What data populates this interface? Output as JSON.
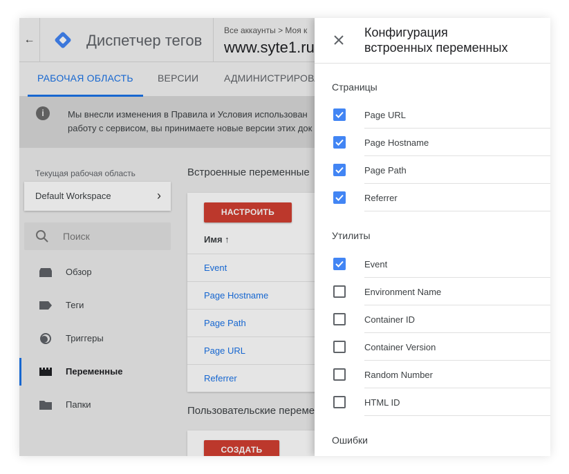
{
  "header": {
    "back_glyph": "←",
    "app_title": "Диспетчер тегов",
    "breadcrumb": "Все аккаунты > Моя к",
    "container_name": "www.syte1.ru"
  },
  "tabs": [
    {
      "label": "РАБОЧАЯ ОБЛАСТЬ",
      "active": true
    },
    {
      "label": "ВЕРСИИ",
      "active": false
    },
    {
      "label": "АДМИНИСТРИРОВА",
      "active": false
    }
  ],
  "notice": {
    "line1": "Мы внесли изменения в Правила и Условия использован",
    "line2": "работу с сервисом, вы принимаете новые версии этих док"
  },
  "workspace": {
    "label": "Текущая рабочая область",
    "name": "Default Workspace",
    "chevron": "›"
  },
  "search": {
    "placeholder": "Поиск"
  },
  "nav": [
    {
      "label": "Обзор",
      "icon": "overview-icon",
      "active": false
    },
    {
      "label": "Теги",
      "icon": "tag-icon",
      "active": false
    },
    {
      "label": "Триггеры",
      "icon": "trigger-icon",
      "active": false
    },
    {
      "label": "Переменные",
      "icon": "variables-icon",
      "active": true
    },
    {
      "label": "Папки",
      "icon": "folder-icon",
      "active": false
    }
  ],
  "builtin": {
    "title": "Встроенные переменные",
    "button": "НАСТРОИТЬ",
    "column": "Имя",
    "sort_glyph": "↑",
    "rows": [
      "Event",
      "Page Hostname",
      "Page Path",
      "Page URL",
      "Referrer"
    ]
  },
  "user_vars": {
    "title": "Пользовательские переме",
    "button": "СОЗДАТЬ"
  },
  "panel": {
    "title_line1": "Конфигурация",
    "title_line2": "встроенных переменных",
    "groups": [
      {
        "label": "Страницы",
        "items": [
          {
            "label": "Page URL",
            "checked": true
          },
          {
            "label": "Page Hostname",
            "checked": true
          },
          {
            "label": "Page Path",
            "checked": true
          },
          {
            "label": "Referrer",
            "checked": true
          }
        ]
      },
      {
        "label": "Утилиты",
        "items": [
          {
            "label": "Event",
            "checked": true
          },
          {
            "label": "Environment Name",
            "checked": false
          },
          {
            "label": "Container ID",
            "checked": false
          },
          {
            "label": "Container Version",
            "checked": false
          },
          {
            "label": "Random Number",
            "checked": false
          },
          {
            "label": "HTML ID",
            "checked": false
          }
        ]
      },
      {
        "label": "Ошибки",
        "items": []
      }
    ]
  },
  "colors": {
    "accent": "#1a73e8",
    "checkbox_on": "#4285f4",
    "primary_button": "#d23f31"
  }
}
